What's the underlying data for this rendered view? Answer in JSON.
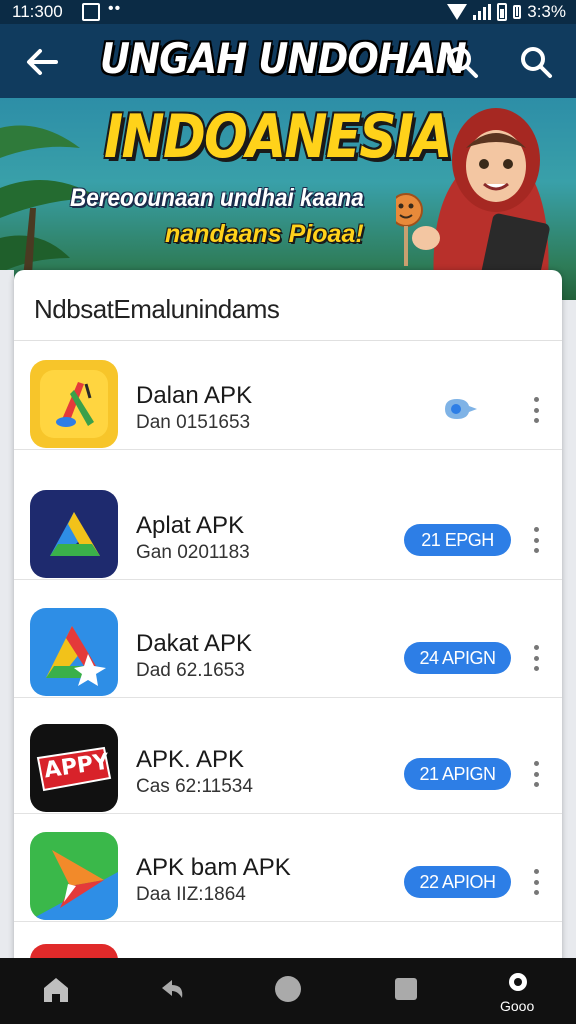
{
  "status_bar": {
    "time": "11:300",
    "dots": "••",
    "battery_text": "3:3%"
  },
  "app_bar": {
    "title": "UNGAH UNDOHAN"
  },
  "banner": {
    "headline": "INDOANESIA",
    "line1": "Bereoounaan undhai kaana",
    "line2": "nandaans Pioaa!"
  },
  "list": {
    "section_title": "NdbsatEmalunindams",
    "apps": [
      {
        "name": "Dalan APK",
        "meta": "Dan 0151653",
        "action": "pin",
        "badge": ""
      },
      {
        "name": "Aplat APK",
        "meta": "Gan 0201183",
        "action": "badge",
        "badge": "21 EPGH"
      },
      {
        "name": "Dakat APK",
        "meta": "Dad 62.1653",
        "action": "badge",
        "badge": "24 APIGN"
      },
      {
        "name": "APK. APK",
        "meta": "Cas 62:11534",
        "action": "badge",
        "badge": "21 APIGN"
      },
      {
        "name": "APK bam APK",
        "meta": "Daa IIZ:1864",
        "action": "badge",
        "badge": "22 APIOH"
      }
    ],
    "apk_icon_text": "APPY"
  },
  "nav": {
    "last_label": "Gooo"
  },
  "colors": {
    "app_bar": "#103b5e",
    "badge": "#2d7ee6",
    "headline": "#ffd21a"
  }
}
